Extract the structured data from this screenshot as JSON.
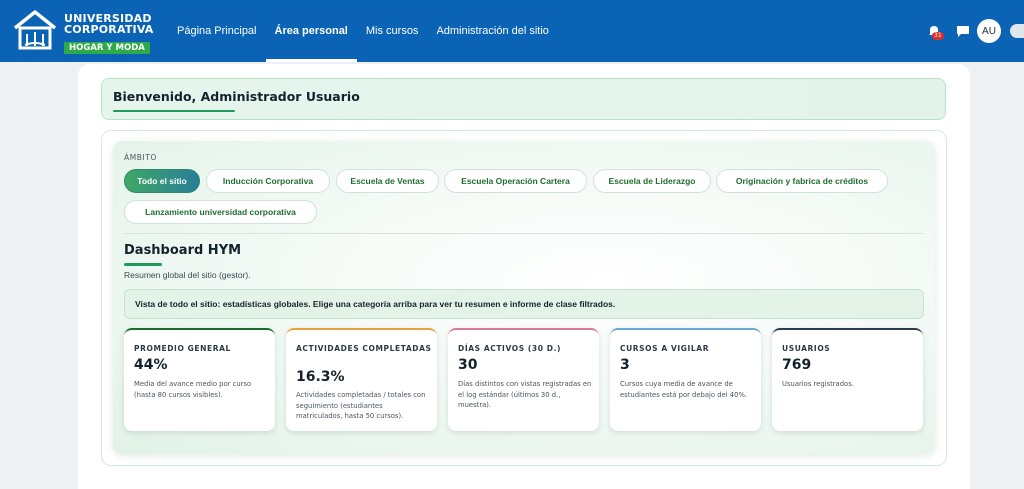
{
  "brand": {
    "line1": "UNIVERSIDAD",
    "line2": "CORPORATIVA",
    "badge": "HOGAR Y MODA"
  },
  "nav": {
    "items": [
      {
        "label": "Página Principal",
        "active": false
      },
      {
        "label": "Área personal",
        "active": true
      },
      {
        "label": "Mis cursos",
        "active": false
      },
      {
        "label": "Administración del sitio",
        "active": false
      }
    ],
    "notification_count": "31",
    "avatar_initials": "AU"
  },
  "welcome": {
    "title": "Bienvenido, Administrador Usuario"
  },
  "scope": {
    "label": "ÁMBITO",
    "chips": [
      {
        "label": "Todo el sitio",
        "active": true
      },
      {
        "label": "Inducción Corporativa",
        "active": false
      },
      {
        "label": "Escuela de Ventas",
        "active": false
      },
      {
        "label": "Escuela Operación Cartera",
        "active": false
      },
      {
        "label": "Escuela de Liderazgo",
        "active": false
      },
      {
        "label": "Originación y fabrica de créditos",
        "active": false
      },
      {
        "label": "Lanzamiento universidad corporativa",
        "active": false
      }
    ]
  },
  "dashboard": {
    "title": "Dashboard HYM",
    "subtitle": "Resumen global del sitio (gestor).",
    "info": "Vista de todo el sitio: estadísticas globales. Elige una categoría arriba para ver tu resumen e informe de clase filtrados."
  },
  "stats": [
    {
      "label": "PROMEDIO GENERAL",
      "value": "44%",
      "desc": "Media del avance medio por curso (hasta 80 cursos visibles).",
      "accent": "#1d6b2c"
    },
    {
      "label": "ACTIVIDADES COMPLETADAS",
      "value": "16.3%",
      "desc": "Actividades completadas / totales con seguimiento (estudiantes matriculados, hasta 50 cursos).",
      "accent": "#e6a23c"
    },
    {
      "label": "DÍAS ACTIVOS (30 D.)",
      "value": "30",
      "desc": "Días distintos con vistas registradas en el log estándar (últimos 30 d., muestra).",
      "accent": "#d9799a"
    },
    {
      "label": "CURSOS A VIGILAR",
      "value": "3",
      "desc": "Cursos cuya media de avance de estudiantes está por debajo del 40%.",
      "accent": "#6aa8d6"
    },
    {
      "label": "USUARIOS",
      "value": "769",
      "desc": "Usuarios registrados.",
      "accent": "#2c3e50"
    }
  ],
  "colors": {
    "navbar": "#0a63b4",
    "brand_green": "#2eaa4a",
    "accent_green": "#1f9a5e",
    "chip_text": "#1f6e2e"
  }
}
